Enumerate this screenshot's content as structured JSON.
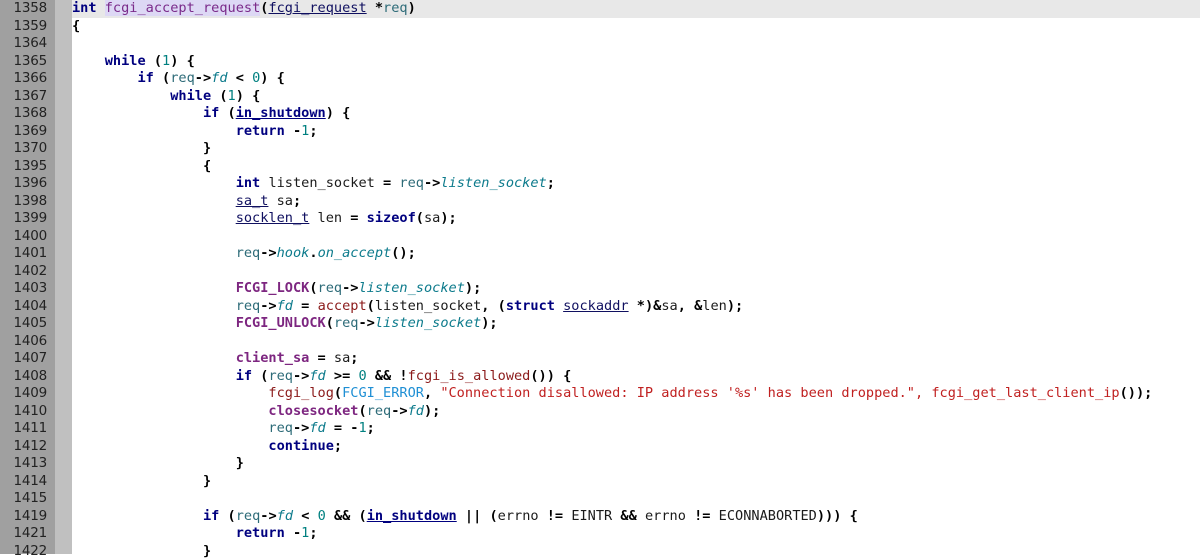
{
  "editor": {
    "kind": "code-editor",
    "language": "C",
    "function_name": "fcgi_accept_request",
    "gutter_color": "#a0a0a0",
    "fold_margin_color": "#c0c0c0",
    "current_line_highlight": "#e8e8e8",
    "current_line_number": "1358",
    "first_visible_line": "1358",
    "last_visible_line": "1422"
  },
  "lines": [
    {
      "n": "1358",
      "fold": "none",
      "cur": true,
      "tokens": [
        {
          "t": "int",
          "c": "kw"
        },
        {
          "t": " ",
          "c": "pln"
        },
        {
          "t": "fcgi_accept_request",
          "c": "fndef"
        },
        {
          "t": "(",
          "c": "bk"
        },
        {
          "t": "fcgi_request",
          "c": "typ"
        },
        {
          "t": " *",
          "c": "op"
        },
        {
          "t": "req",
          "c": "var"
        },
        {
          "t": ")",
          "c": "bk"
        }
      ]
    },
    {
      "n": "1359",
      "fold": "box",
      "tokens": [
        {
          "t": "{",
          "c": "bk"
        }
      ]
    },
    {
      "n": "1364",
      "fold": "line",
      "tokens": []
    },
    {
      "n": "1365",
      "fold": "box",
      "tokens": [
        {
          "t": "    ",
          "c": "pln"
        },
        {
          "t": "while",
          "c": "kw"
        },
        {
          "t": " (",
          "c": "bk"
        },
        {
          "t": "1",
          "c": "num"
        },
        {
          "t": ") {",
          "c": "bk"
        }
      ]
    },
    {
      "n": "1366",
      "fold": "box",
      "tokens": [
        {
          "t": "        ",
          "c": "pln"
        },
        {
          "t": "if",
          "c": "kw"
        },
        {
          "t": " (",
          "c": "bk"
        },
        {
          "t": "req",
          "c": "var"
        },
        {
          "t": "->",
          "c": "op"
        },
        {
          "t": "fd",
          "c": "mem"
        },
        {
          "t": " < ",
          "c": "op"
        },
        {
          "t": "0",
          "c": "num"
        },
        {
          "t": ") {",
          "c": "bk"
        }
      ]
    },
    {
      "n": "1367",
      "fold": "box",
      "tokens": [
        {
          "t": "            ",
          "c": "pln"
        },
        {
          "t": "while",
          "c": "kw"
        },
        {
          "t": " (",
          "c": "bk"
        },
        {
          "t": "1",
          "c": "num"
        },
        {
          "t": ") {",
          "c": "bk"
        }
      ]
    },
    {
      "n": "1368",
      "fold": "box",
      "tokens": [
        {
          "t": "                ",
          "c": "pln"
        },
        {
          "t": "if",
          "c": "kw"
        },
        {
          "t": " (",
          "c": "bk"
        },
        {
          "t": "in_shutdown",
          "c": "glob"
        },
        {
          "t": ") {",
          "c": "bk"
        }
      ]
    },
    {
      "n": "1369",
      "fold": "line",
      "tokens": [
        {
          "t": "                    ",
          "c": "pln"
        },
        {
          "t": "return",
          "c": "kw"
        },
        {
          "t": " ",
          "c": "pln"
        },
        {
          "t": "-",
          "c": "op"
        },
        {
          "t": "1",
          "c": "num"
        },
        {
          "t": ";",
          "c": "bk"
        }
      ]
    },
    {
      "n": "1370",
      "fold": "line",
      "tokens": [
        {
          "t": "                ",
          "c": "pln"
        },
        {
          "t": "}",
          "c": "bk"
        }
      ]
    },
    {
      "n": "1395",
      "fold": "box",
      "tokens": [
        {
          "t": "                ",
          "c": "pln"
        },
        {
          "t": "{",
          "c": "bk"
        }
      ]
    },
    {
      "n": "1396",
      "fold": "line",
      "tokens": [
        {
          "t": "                    ",
          "c": "pln"
        },
        {
          "t": "int",
          "c": "kw"
        },
        {
          "t": " ",
          "c": "pln"
        },
        {
          "t": "listen_socket",
          "c": "pln"
        },
        {
          "t": " = ",
          "c": "op"
        },
        {
          "t": "req",
          "c": "var"
        },
        {
          "t": "->",
          "c": "op"
        },
        {
          "t": "listen_socket",
          "c": "mem"
        },
        {
          "t": ";",
          "c": "bk"
        }
      ]
    },
    {
      "n": "1398",
      "fold": "line",
      "tokens": [
        {
          "t": "                    ",
          "c": "pln"
        },
        {
          "t": "sa_t",
          "c": "typ"
        },
        {
          "t": " ",
          "c": "pln"
        },
        {
          "t": "sa",
          "c": "pln"
        },
        {
          "t": ";",
          "c": "bk"
        }
      ]
    },
    {
      "n": "1399",
      "fold": "line",
      "tokens": [
        {
          "t": "                    ",
          "c": "pln"
        },
        {
          "t": "socklen_t",
          "c": "typ"
        },
        {
          "t": " ",
          "c": "pln"
        },
        {
          "t": "len",
          "c": "pln"
        },
        {
          "t": " = ",
          "c": "op"
        },
        {
          "t": "sizeof",
          "c": "kw"
        },
        {
          "t": "(",
          "c": "bk"
        },
        {
          "t": "sa",
          "c": "pln"
        },
        {
          "t": ");",
          "c": "bk"
        }
      ]
    },
    {
      "n": "1400",
      "fold": "line",
      "tokens": []
    },
    {
      "n": "1401",
      "fold": "line",
      "tokens": [
        {
          "t": "                    ",
          "c": "pln"
        },
        {
          "t": "req",
          "c": "var"
        },
        {
          "t": "->",
          "c": "op"
        },
        {
          "t": "hook",
          "c": "mem"
        },
        {
          "t": ".",
          "c": "bk"
        },
        {
          "t": "on_accept",
          "c": "mem"
        },
        {
          "t": "();",
          "c": "bk"
        }
      ]
    },
    {
      "n": "1402",
      "fold": "line",
      "tokens": []
    },
    {
      "n": "1403",
      "fold": "line",
      "tokens": [
        {
          "t": "                    ",
          "c": "pln"
        },
        {
          "t": "FCGI_LOCK",
          "c": "macro"
        },
        {
          "t": "(",
          "c": "bk"
        },
        {
          "t": "req",
          "c": "var"
        },
        {
          "t": "->",
          "c": "op"
        },
        {
          "t": "listen_socket",
          "c": "mem"
        },
        {
          "t": ");",
          "c": "bk"
        }
      ]
    },
    {
      "n": "1404",
      "fold": "line",
      "tokens": [
        {
          "t": "                    ",
          "c": "pln"
        },
        {
          "t": "req",
          "c": "var"
        },
        {
          "t": "->",
          "c": "op"
        },
        {
          "t": "fd",
          "c": "mem"
        },
        {
          "t": " = ",
          "c": "op"
        },
        {
          "t": "accept",
          "c": "fn"
        },
        {
          "t": "(",
          "c": "bk"
        },
        {
          "t": "listen_socket",
          "c": "pln"
        },
        {
          "t": ", (",
          "c": "bk"
        },
        {
          "t": "struct",
          "c": "kw"
        },
        {
          "t": " ",
          "c": "pln"
        },
        {
          "t": "sockaddr",
          "c": "typ"
        },
        {
          "t": " *",
          "c": "op"
        },
        {
          "t": ")&",
          "c": "op"
        },
        {
          "t": "sa",
          "c": "pln"
        },
        {
          "t": ", &",
          "c": "op"
        },
        {
          "t": "len",
          "c": "pln"
        },
        {
          "t": ");",
          "c": "bk"
        }
      ]
    },
    {
      "n": "1405",
      "fold": "line",
      "tokens": [
        {
          "t": "                    ",
          "c": "pln"
        },
        {
          "t": "FCGI_UNLOCK",
          "c": "macro"
        },
        {
          "t": "(",
          "c": "bk"
        },
        {
          "t": "req",
          "c": "var"
        },
        {
          "t": "->",
          "c": "op"
        },
        {
          "t": "listen_socket",
          "c": "mem"
        },
        {
          "t": ");",
          "c": "bk"
        }
      ]
    },
    {
      "n": "1406",
      "fold": "line",
      "tokens": []
    },
    {
      "n": "1407",
      "fold": "line",
      "tokens": [
        {
          "t": "                    ",
          "c": "pln"
        },
        {
          "t": "client_sa",
          "c": "macro"
        },
        {
          "t": " = ",
          "c": "op"
        },
        {
          "t": "sa",
          "c": "pln"
        },
        {
          "t": ";",
          "c": "bk"
        }
      ]
    },
    {
      "n": "1408",
      "fold": "box",
      "tokens": [
        {
          "t": "                    ",
          "c": "pln"
        },
        {
          "t": "if",
          "c": "kw"
        },
        {
          "t": " (",
          "c": "bk"
        },
        {
          "t": "req",
          "c": "var"
        },
        {
          "t": "->",
          "c": "op"
        },
        {
          "t": "fd",
          "c": "mem"
        },
        {
          "t": " >= ",
          "c": "op"
        },
        {
          "t": "0",
          "c": "num"
        },
        {
          "t": " && !",
          "c": "op"
        },
        {
          "t": "fcgi_is_allowed",
          "c": "fn"
        },
        {
          "t": "()) {",
          "c": "bk"
        }
      ]
    },
    {
      "n": "1409",
      "fold": "line",
      "tokens": [
        {
          "t": "                        ",
          "c": "pln"
        },
        {
          "t": "fcgi_log",
          "c": "fn"
        },
        {
          "t": "(",
          "c": "bk"
        },
        {
          "t": "FCGI_ERROR",
          "c": "mac2"
        },
        {
          "t": ", ",
          "c": "bk"
        },
        {
          "t": "\"Connection disallowed: IP address '%s' has been dropped.\", fcgi_get_last_client_ip",
          "c": "strtail"
        },
        {
          "t": "());",
          "c": "bk"
        }
      ]
    },
    {
      "n": "1410",
      "fold": "line",
      "tokens": [
        {
          "t": "                        ",
          "c": "pln"
        },
        {
          "t": "closesocket",
          "c": "macro"
        },
        {
          "t": "(",
          "c": "bk"
        },
        {
          "t": "req",
          "c": "var"
        },
        {
          "t": "->",
          "c": "op"
        },
        {
          "t": "fd",
          "c": "mem"
        },
        {
          "t": ");",
          "c": "bk"
        }
      ]
    },
    {
      "n": "1411",
      "fold": "line",
      "tokens": [
        {
          "t": "                        ",
          "c": "pln"
        },
        {
          "t": "req",
          "c": "var"
        },
        {
          "t": "->",
          "c": "op"
        },
        {
          "t": "fd",
          "c": "mem"
        },
        {
          "t": " = ",
          "c": "op"
        },
        {
          "t": "-",
          "c": "op"
        },
        {
          "t": "1",
          "c": "num"
        },
        {
          "t": ";",
          "c": "bk"
        }
      ]
    },
    {
      "n": "1412",
      "fold": "line",
      "tokens": [
        {
          "t": "                        ",
          "c": "pln"
        },
        {
          "t": "continue",
          "c": "kw"
        },
        {
          "t": ";",
          "c": "bk"
        }
      ]
    },
    {
      "n": "1413",
      "fold": "cap",
      "tokens": [
        {
          "t": "                    ",
          "c": "pln"
        },
        {
          "t": "}",
          "c": "bk"
        }
      ]
    },
    {
      "n": "1414",
      "fold": "cap",
      "tokens": [
        {
          "t": "                ",
          "c": "pln"
        },
        {
          "t": "}",
          "c": "bk"
        }
      ]
    },
    {
      "n": "1415",
      "fold": "line",
      "tokens": []
    },
    {
      "n": "1419",
      "fold": "box",
      "tokens": [
        {
          "t": "                ",
          "c": "pln"
        },
        {
          "t": "if",
          "c": "kw"
        },
        {
          "t": " (",
          "c": "bk"
        },
        {
          "t": "req",
          "c": "var"
        },
        {
          "t": "->",
          "c": "op"
        },
        {
          "t": "fd",
          "c": "mem"
        },
        {
          "t": " < ",
          "c": "op"
        },
        {
          "t": "0",
          "c": "num"
        },
        {
          "t": " && (",
          "c": "op"
        },
        {
          "t": "in_shutdown",
          "c": "glob"
        },
        {
          "t": " || (",
          "c": "op"
        },
        {
          "t": "errno",
          "c": "pln"
        },
        {
          "t": " != ",
          "c": "op"
        },
        {
          "t": "EINTR",
          "c": "pln"
        },
        {
          "t": " && ",
          "c": "op"
        },
        {
          "t": "errno",
          "c": "pln"
        },
        {
          "t": " != ",
          "c": "op"
        },
        {
          "t": "ECONNABORTED",
          "c": "pln"
        },
        {
          "t": "))) {",
          "c": "bk"
        }
      ]
    },
    {
      "n": "1421",
      "fold": "line",
      "tokens": [
        {
          "t": "                    ",
          "c": "pln"
        },
        {
          "t": "return",
          "c": "kw"
        },
        {
          "t": " ",
          "c": "pln"
        },
        {
          "t": "-",
          "c": "op"
        },
        {
          "t": "1",
          "c": "num"
        },
        {
          "t": ";",
          "c": "bk"
        }
      ]
    },
    {
      "n": "1422",
      "fold": "cap",
      "tokens": [
        {
          "t": "                ",
          "c": "pln"
        },
        {
          "t": "}",
          "c": "bk"
        }
      ]
    }
  ]
}
